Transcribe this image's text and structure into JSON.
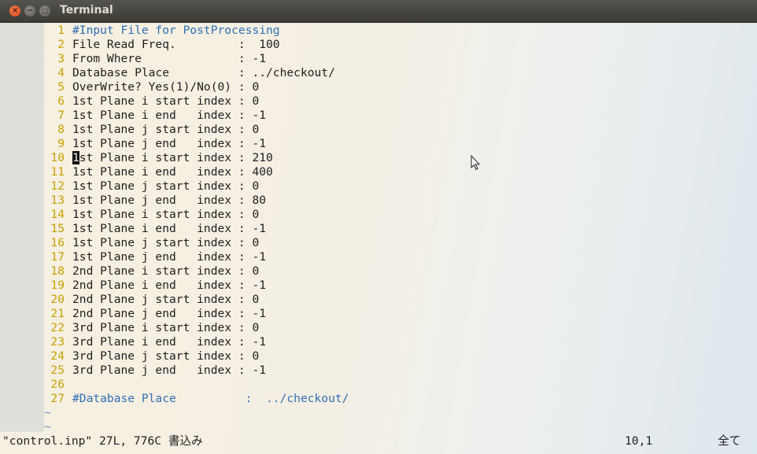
{
  "window": {
    "title": "Terminal"
  },
  "lines": [
    {
      "n": "1",
      "text": "#Input File for PostProcessing",
      "comment": true
    },
    {
      "n": "2",
      "text": "File Read Freq.         :  100"
    },
    {
      "n": "3",
      "text": "From Where              : -1"
    },
    {
      "n": "4",
      "text": "Database Place          : ../checkout/"
    },
    {
      "n": "5",
      "text": "OverWrite? Yes(1)/No(0) : 0"
    },
    {
      "n": "6",
      "text": "1st Plane i start index : 0"
    },
    {
      "n": "7",
      "text": "1st Plane i end   index : -1"
    },
    {
      "n": "8",
      "text": "1st Plane j start index : 0"
    },
    {
      "n": "9",
      "text": "1st Plane j end   index : -1"
    },
    {
      "n": "10",
      "text": "1st Plane i start index : 210",
      "cursor": true
    },
    {
      "n": "11",
      "text": "1st Plane i end   index : 400"
    },
    {
      "n": "12",
      "text": "1st Plane j start index : 0"
    },
    {
      "n": "13",
      "text": "1st Plane j end   index : 80"
    },
    {
      "n": "14",
      "text": "1st Plane i start index : 0"
    },
    {
      "n": "15",
      "text": "1st Plane i end   index : -1"
    },
    {
      "n": "16",
      "text": "1st Plane j start index : 0"
    },
    {
      "n": "17",
      "text": "1st Plane j end   index : -1"
    },
    {
      "n": "18",
      "text": "2nd Plane i start index : 0"
    },
    {
      "n": "19",
      "text": "2nd Plane i end   index : -1"
    },
    {
      "n": "20",
      "text": "2nd Plane j start index : 0"
    },
    {
      "n": "21",
      "text": "2nd Plane j end   index : -1"
    },
    {
      "n": "22",
      "text": "3rd Plane i start index : 0"
    },
    {
      "n": "23",
      "text": "3rd Plane i end   index : -1"
    },
    {
      "n": "24",
      "text": "3rd Plane j start index : 0"
    },
    {
      "n": "25",
      "text": "3rd Plane j end   index : -1"
    },
    {
      "n": "26",
      "text": ""
    },
    {
      "n": "27",
      "text": "#Database Place          :  ../checkout/",
      "comment": true
    }
  ],
  "tildes": [
    "~",
    "~"
  ],
  "status": {
    "file": "\"control.inp\" 27L, 776C 書込み",
    "position": "10,1",
    "scroll": "全て"
  },
  "colors": {
    "line_number": "#c8a000",
    "comment": "#2f6eb5",
    "tilde": "#5f8fcf",
    "text": "#1e1e1e"
  }
}
